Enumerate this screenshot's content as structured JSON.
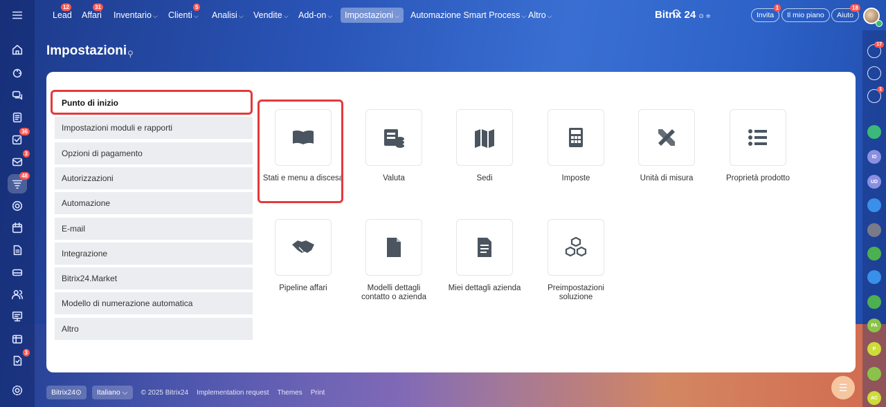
{
  "topnav": {
    "items": [
      {
        "label": "Lead",
        "badge": "12",
        "chevron": ""
      },
      {
        "label": "Affari",
        "badge": "31",
        "chevron": ""
      },
      {
        "label": "Inventario",
        "badge": "",
        "chevron": "⌵"
      },
      {
        "label": "Clienti",
        "badge": "5",
        "chevron": "⌵"
      },
      {
        "label": "Analisi",
        "badge": "",
        "chevron": "⌵"
      },
      {
        "label": "Vendite",
        "badge": "",
        "chevron": "⌵"
      },
      {
        "label": "Add-on",
        "badge": "",
        "chevron": "⌵"
      },
      {
        "label": "Impostazioni",
        "badge": "",
        "chevron": "⌵"
      },
      {
        "label": "Automazione Smart Process",
        "badge": "",
        "chevron": "⌵"
      },
      {
        "label": "Altro",
        "badge": "",
        "chevron": "⌵"
      }
    ],
    "brand": "Bitrix 24",
    "brand_suffix": "⊙ ≑",
    "invite": {
      "label": "Invita",
      "badge": "1"
    },
    "plan": {
      "label": "Il mio piano"
    },
    "help": {
      "label": "Aiuto",
      "badge": "18"
    }
  },
  "leftbar": {
    "badges": {
      "tasks": "36",
      "mail": "3",
      "crm": "48",
      "approvals": "3"
    }
  },
  "rightbar": {
    "items": [
      {
        "text": "",
        "badge": "17",
        "color": "transparent"
      },
      {
        "text": "",
        "badge": "",
        "color": "transparent"
      },
      {
        "text": "",
        "badge": "1",
        "color": "transparent"
      },
      {
        "text": "",
        "badge": "",
        "color": "#3cb878"
      },
      {
        "text": "ID",
        "badge": "",
        "color": "#8a8fe0"
      },
      {
        "text": "UD",
        "badge": "",
        "color": "#8a8fe0"
      },
      {
        "text": "",
        "badge": "",
        "color": "#3a8fe8"
      },
      {
        "text": "",
        "badge": "",
        "color": "#7a7a8a"
      },
      {
        "text": "",
        "badge": "",
        "color": "#4caf50"
      },
      {
        "text": "",
        "badge": "",
        "color": "#3a8fe8"
      },
      {
        "text": "",
        "badge": "",
        "color": "#4caf50"
      },
      {
        "text": "PA",
        "badge": "",
        "color": "#8bc34a"
      },
      {
        "text": "P",
        "badge": "",
        "color": "#cddc39"
      },
      {
        "text": "",
        "badge": "",
        "color": "#8bc34a"
      },
      {
        "text": "AC",
        "badge": "",
        "color": "#cddc39"
      }
    ]
  },
  "page": {
    "title": "Impostazioni",
    "pin": "⚲"
  },
  "menu": {
    "items": [
      "Punto di inizio",
      "Impostazioni moduli e rapporti",
      "Opzioni di pagamento",
      "Autorizzazioni",
      "Automazione",
      "E-mail",
      "Integrazione",
      "Bitrix24.Market",
      "Modello di numerazione automatica",
      "Altro"
    ],
    "selected": "Punto di inizio"
  },
  "tiles": [
    {
      "label": "Stati e menu a discesa",
      "icon": "book-icon"
    },
    {
      "label": "Valuta",
      "icon": "currency-icon"
    },
    {
      "label": "Sedi",
      "icon": "map-icon"
    },
    {
      "label": "Imposte",
      "icon": "calculator-icon"
    },
    {
      "label": "Unità di misura",
      "icon": "ruler-pencil-icon"
    },
    {
      "label": "Proprietà prodotto",
      "icon": "list-icon"
    },
    {
      "label": "Pipeline affari",
      "icon": "handshake-icon"
    },
    {
      "label": "Modelli dettagli contatto o azienda",
      "icon": "document-icon"
    },
    {
      "label": "Miei dettagli azienda",
      "icon": "file-text-icon"
    },
    {
      "label": "Preimpostazioni soluzione",
      "icon": "cubes-icon"
    }
  ],
  "footer": {
    "brand": "Bitrix24⊙",
    "language": "Italiano",
    "copyright": "© 2025 Bitrix24",
    "implementation": "Implementation request",
    "themes": "Themes",
    "print": "Print"
  },
  "colors": {
    "highlight": "#e4393c",
    "badge": "#ff5752",
    "menu_bg": "#ebedf0"
  }
}
